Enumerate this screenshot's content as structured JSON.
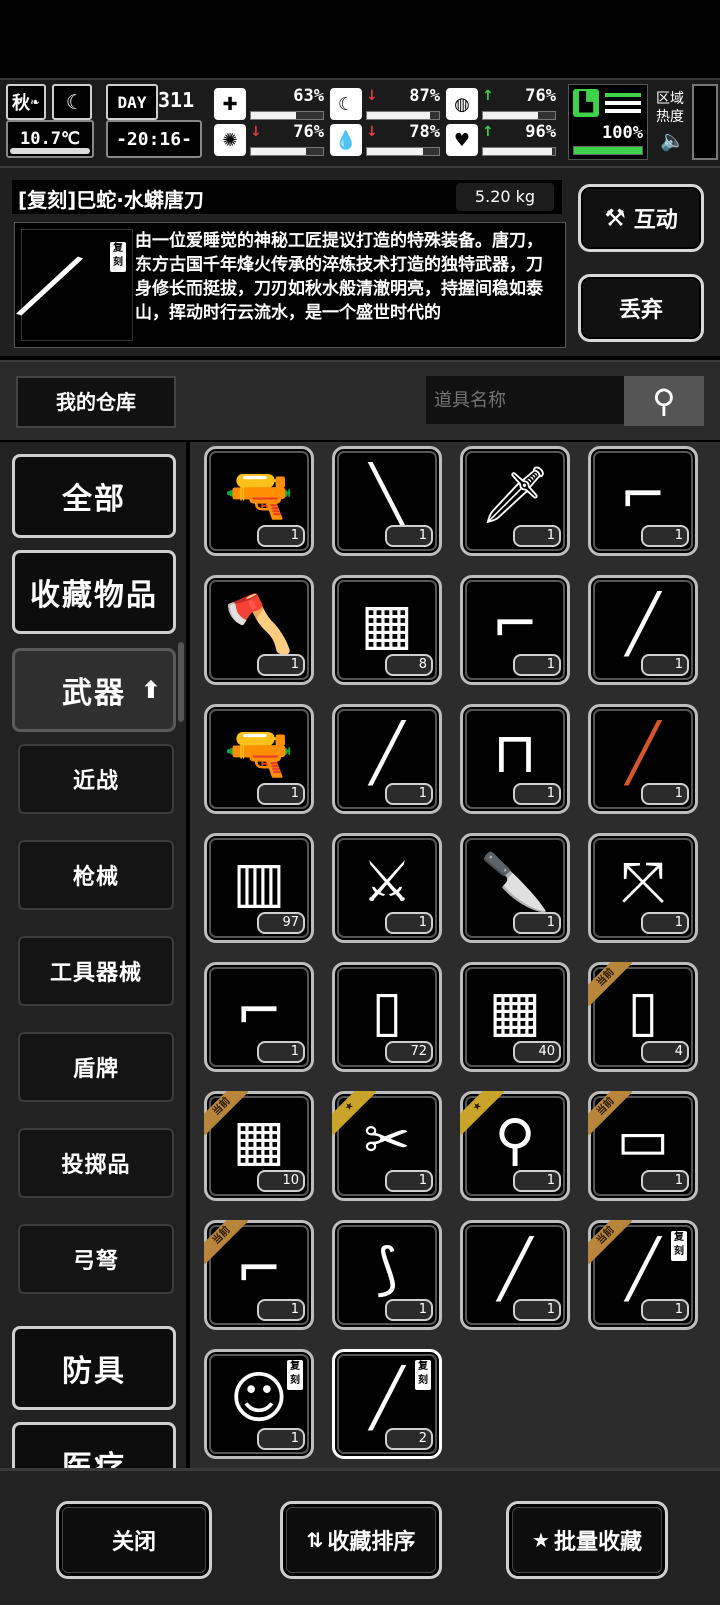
{
  "status": {
    "season": "秋",
    "temperature": "10.7℃",
    "day_label": "DAY",
    "day": "311",
    "clock": "-20:16-",
    "stats": [
      {
        "icon": "medkit-icon",
        "glyph": "✚",
        "arrow": "",
        "arrow_color": "",
        "value": "63%",
        "level": 0.63
      },
      {
        "icon": "stomach-icon",
        "glyph": "☾",
        "arrow": "↓",
        "arrow_color": "#e23b3b",
        "value": "87%",
        "level": 0.87
      },
      {
        "icon": "stamina-icon",
        "glyph": "◍",
        "arrow": "↑",
        "arrow_color": "#3fd14a",
        "value": "76%",
        "level": 0.76
      },
      {
        "icon": "brain-icon",
        "glyph": "✺",
        "arrow": "↓",
        "arrow_color": "#e23b3b",
        "value": "76%",
        "level": 0.76
      },
      {
        "icon": "water-drop-icon",
        "glyph": "💧",
        "arrow": "↓",
        "arrow_color": "#e23b3b",
        "value": "78%",
        "level": 0.78
      },
      {
        "icon": "heart-icon",
        "glyph": "♥",
        "arrow": "↑",
        "arrow_color": "#3fd14a",
        "value": "96%",
        "level": 0.96
      }
    ],
    "boot_value": "100%",
    "boot_level": 1.0,
    "region_heat_label": "区域热度",
    "accent_green": "#3fd14a"
  },
  "item": {
    "name": "[复刻]巳蛇·水蟒唐刀",
    "weight": "5.20 kg",
    "description": "由一位爱睡觉的神秘工匠提议打造的特殊装备。唐刀，东方古国千年烽火传承的淬炼技术打造的独特武器，刀身修长而挺拔，刀刃如秋水般清澈明亮，持握间稳如泰山，挥动时行云流水，是一个盛世时代的",
    "badge": "复刻",
    "interact_label": "互动",
    "discard_label": "丢弃"
  },
  "search": {
    "warehouse_label": "我的仓库",
    "placeholder": "道具名称"
  },
  "nav": {
    "all": "全部",
    "favorites": "收藏物品",
    "weapons": "武器",
    "subs": [
      "近战",
      "枪械",
      "工具器械",
      "盾牌",
      "投掷品",
      "弓弩"
    ],
    "armor": "防具",
    "medical": "医疗"
  },
  "grid": {
    "items": [
      {
        "icon": "pistol-icon",
        "glyph": "🔫",
        "count": "1",
        "tag": ""
      },
      {
        "icon": "baton-icon",
        "glyph": "╲",
        "count": "1",
        "tag": ""
      },
      {
        "icon": "machete-icon",
        "glyph": "🗡",
        "count": "1",
        "tag": ""
      },
      {
        "icon": "assault-rifle-icon",
        "glyph": "⌐",
        "count": "1",
        "tag": ""
      },
      {
        "icon": "hammer-axe-icon",
        "glyph": "🪓",
        "count": "1",
        "tag": ""
      },
      {
        "icon": "net-trap-icon",
        "glyph": "▦",
        "count": "8",
        "tag": ""
      },
      {
        "icon": "revolver-icon",
        "glyph": "⌐",
        "count": "1",
        "tag": ""
      },
      {
        "icon": "screwdriver-icon",
        "glyph": "╱",
        "count": "1",
        "tag": ""
      },
      {
        "icon": "desert-eagle-icon",
        "glyph": "🔫",
        "count": "1",
        "tag": ""
      },
      {
        "icon": "scalpel-icon",
        "glyph": "╱",
        "count": "1",
        "tag": ""
      },
      {
        "icon": "nail-gun-icon",
        "glyph": "⊓",
        "count": "1",
        "tag": ""
      },
      {
        "icon": "rpg-launcher-icon",
        "glyph": "╱",
        "count": "1",
        "tag": "",
        "color": "#d8552a"
      },
      {
        "icon": "ammo-box-icon",
        "glyph": "▥",
        "count": "97",
        "tag": ""
      },
      {
        "icon": "sabre-icon",
        "glyph": "⚔",
        "count": "1",
        "tag": ""
      },
      {
        "icon": "knife-icon",
        "glyph": "🔪",
        "count": "1",
        "tag": ""
      },
      {
        "icon": "crossbow-icon",
        "glyph": "⤧",
        "count": "1",
        "tag": ""
      },
      {
        "icon": "rifle-icon",
        "glyph": "⌐",
        "count": "1",
        "tag": ""
      },
      {
        "icon": "water-bottle-icon",
        "glyph": "▯",
        "count": "72",
        "tag": ""
      },
      {
        "icon": "net-trap-icon",
        "glyph": "▦",
        "count": "40",
        "tag": ""
      },
      {
        "icon": "water-bottle-icon",
        "glyph": "▯",
        "count": "4",
        "tag": "当前"
      },
      {
        "icon": "net-trap-icon",
        "glyph": "▦",
        "count": "10",
        "tag": "当前"
      },
      {
        "icon": "multitool-icon",
        "glyph": "✂",
        "count": "1",
        "tag": "star"
      },
      {
        "icon": "shovel-icon",
        "glyph": "⚲",
        "count": "1",
        "tag": "star"
      },
      {
        "icon": "armor-plate-icon",
        "glyph": "▭",
        "count": "1",
        "tag": "当前"
      },
      {
        "icon": "sniper-rifle-icon",
        "glyph": "⌐",
        "count": "1",
        "tag": "当前"
      },
      {
        "icon": "compound-bow-icon",
        "glyph": "⟆",
        "count": "1",
        "tag": ""
      },
      {
        "icon": "katana-icon",
        "glyph": "╱",
        "count": "1",
        "tag": ""
      },
      {
        "icon": "snake-katana-icon",
        "glyph": "╱",
        "count": "1",
        "tag": "当前",
        "badge": "复刻"
      },
      {
        "icon": "medusa-mask-icon",
        "glyph": "☺",
        "count": "1",
        "tag": "",
        "badge": "复刻"
      },
      {
        "icon": "snake-katana-icon",
        "glyph": "╱",
        "count": "2",
        "tag": "",
        "badge": "复刻",
        "selected": true
      }
    ]
  },
  "bottom": {
    "close": "关闭",
    "sort_favorites": "收藏排序",
    "batch_favorite": "批量收藏"
  }
}
